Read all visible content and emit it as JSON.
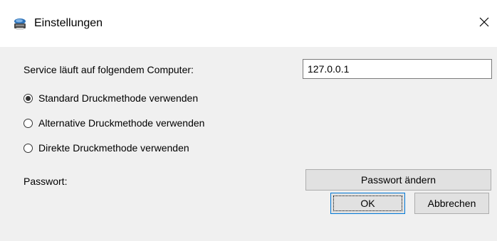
{
  "window": {
    "title": "Einstellungen",
    "title_icon": "printer-network-icon",
    "close_icon": "close-icon"
  },
  "service": {
    "label": "Service läuft auf folgendem Computer:",
    "value": "127.0.0.1"
  },
  "print_methods": {
    "options": [
      {
        "label": "Standard Druckmethode verwenden",
        "checked": true
      },
      {
        "label": "Alternative Druckmethode verwenden",
        "checked": false
      },
      {
        "label": "Direkte Druckmethode verwenden",
        "checked": false
      }
    ]
  },
  "password": {
    "label": "Passwort:",
    "change_button": "Passwort ändern"
  },
  "buttons": {
    "ok": "OK",
    "cancel": "Abbrechen"
  },
  "colors": {
    "focus_border": "#0078d7",
    "dialog_bg": "#f0f0f0",
    "button_bg": "#e1e1e1"
  }
}
